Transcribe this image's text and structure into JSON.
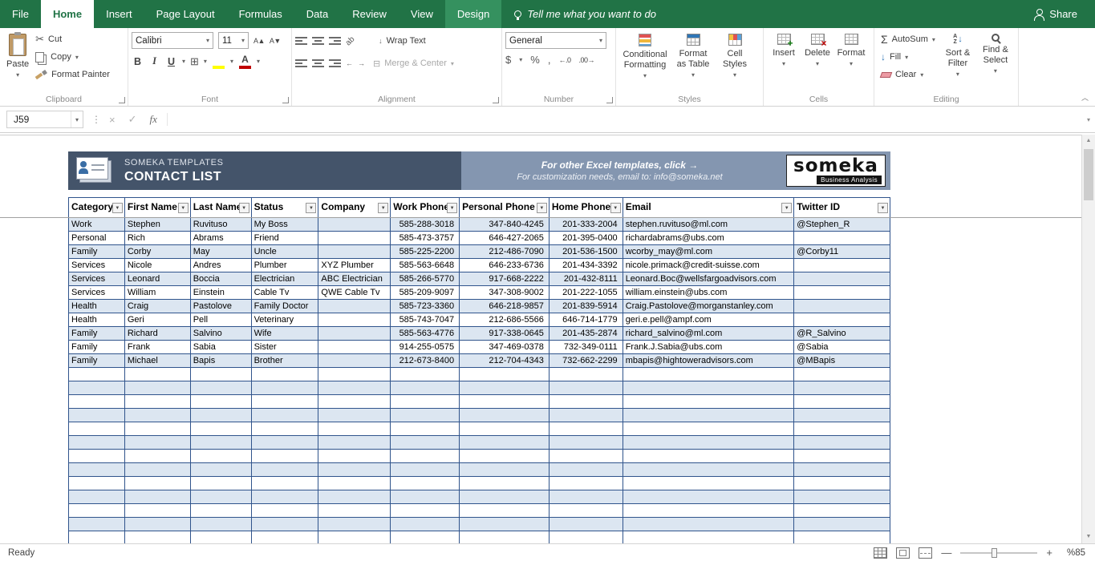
{
  "colors": {
    "excel_green": "#217346",
    "tab_contextual": "#35915f",
    "banner_dark": "#44546A",
    "banner_light": "#8496B0",
    "row_alt": "#DCE6F1",
    "table_border": "#30548C"
  },
  "icons": {
    "dropdown": "▾",
    "filter": "▼",
    "scissors": "✂",
    "borders": "⊞",
    "merge": "⊟",
    "sum": "Σ",
    "fill_arrow": "↓",
    "check": "✓",
    "close": "×",
    "dots": "⋮",
    "up_small": "▲",
    "down_small": "▼",
    "collapse": "︿",
    "money": "$",
    "percent": "%",
    "comma": ",",
    "inc_decimal": "←.0",
    "dec_decimal": ".00→",
    "font_up": "A▲",
    "font_down": "A▼",
    "orientation": "ab",
    "indent_left": "←",
    "indent_right": "→"
  },
  "app": {
    "tabs": [
      "File",
      "Home",
      "Insert",
      "Page Layout",
      "Formulas",
      "Data",
      "Review",
      "View",
      "Design"
    ],
    "active_tab": "Home",
    "contextual_tab": "Design",
    "tell_me": "Tell me what you want to do",
    "share_label": "Share"
  },
  "ribbon": {
    "clipboard": {
      "title": "Clipboard",
      "paste": "Paste",
      "cut": "Cut",
      "copy": "Copy",
      "format_painter": "Format Painter"
    },
    "font": {
      "title": "Font",
      "font_name": "Calibri",
      "font_size": "11",
      "bold": "B",
      "italic": "I",
      "underline": "U",
      "color_letter": "A"
    },
    "alignment": {
      "title": "Alignment",
      "wrap_text": "Wrap Text",
      "merge_center": "Merge & Center"
    },
    "number": {
      "title": "Number",
      "format": "General"
    },
    "styles": {
      "title": "Styles",
      "conditional": "Conditional Formatting",
      "format_table": "Format as Table",
      "cell_styles": "Cell Styles"
    },
    "cells": {
      "title": "Cells",
      "insert": "Insert",
      "delete": "Delete",
      "format": "Format"
    },
    "editing": {
      "title": "Editing",
      "autosum": "AutoSum",
      "fill": "Fill",
      "clear": "Clear",
      "sort_filter": "Sort & Filter",
      "find_select": "Find & Select"
    }
  },
  "formula_bar": {
    "name_box": "J59",
    "fx": "fx",
    "value": ""
  },
  "banner": {
    "brand": "SOMEKA TEMPLATES",
    "title": "CONTACT LIST",
    "promo_line1": "For other Excel templates, click →",
    "promo_line2": "For customization needs, email to: info@someka.net",
    "logo_text": "someka",
    "logo_sub": "Business Analysis"
  },
  "table": {
    "columns": [
      "Category",
      "First Name",
      "Last Name",
      "Status",
      "Company",
      "Work Phone",
      "Personal Phone",
      "Home Phone",
      "Email",
      "Twitter ID"
    ],
    "rows": [
      [
        "Work",
        "Stephen",
        "Ruvituso",
        "My Boss",
        "",
        "585-288-3018",
        "347-840-4245",
        "201-333-2004",
        "stephen.ruvituso@ml.com",
        "@Stephen_R"
      ],
      [
        "Personal",
        "Rich",
        "Abrams",
        "Friend",
        "",
        "585-473-3757",
        "646-427-2065",
        "201-395-0400",
        "richardabrams@ubs.com",
        ""
      ],
      [
        "Family",
        "Corby",
        "May",
        "Uncle",
        "",
        "585-225-2200",
        "212-486-7090",
        "201-536-1500",
        "wcorby_may@ml.com",
        "@Corby11"
      ],
      [
        "Services",
        "Nicole",
        "Andres",
        "Plumber",
        "XYZ Plumber",
        "585-563-6648",
        "646-233-6736",
        "201-434-3392",
        "nicole.primack@credit-suisse.com",
        ""
      ],
      [
        "Services",
        "Leonard",
        "Boccia",
        "Electrician",
        "ABC Electrician",
        "585-266-5770",
        "917-668-2222",
        "201-432-8111",
        "Leonard.Boc@wellsfargoadvisors.com",
        ""
      ],
      [
        "Services",
        "William",
        "Einstein",
        "Cable Tv",
        "QWE Cable Tv",
        "585-209-9097",
        "347-308-9002",
        "201-222-1055",
        "william.einstein@ubs.com",
        ""
      ],
      [
        "Health",
        "Craig",
        "Pastolove",
        "Family Doctor",
        "",
        "585-723-3360",
        "646-218-9857",
        "201-839-5914",
        "Craig.Pastolove@morganstanley.com",
        ""
      ],
      [
        "Health",
        "Geri",
        "Pell",
        "Veterinary",
        "",
        "585-743-7047",
        "212-686-5566",
        "646-714-1779",
        "geri.e.pell@ampf.com",
        ""
      ],
      [
        "Family",
        "Richard",
        "Salvino",
        "Wife",
        "",
        "585-563-4776",
        "917-338-0645",
        "201-435-2874",
        "richard_salvino@ml.com",
        "@R_Salvino"
      ],
      [
        "Family",
        "Frank",
        "Sabia",
        "Sister",
        "",
        "914-255-0575",
        "347-469-0378",
        "732-349-0111",
        "Frank.J.Sabia@ubs.com",
        "@Sabia"
      ],
      [
        "Family",
        "Michael",
        "Bapis",
        "Brother",
        "",
        "212-673-8400",
        "212-704-4343",
        "732-662-2299",
        "mbapis@hightoweradvisors.com",
        "@MBapis"
      ]
    ],
    "empty_row_count": 13
  },
  "status_bar": {
    "ready": "Ready",
    "zoom": "%85"
  }
}
